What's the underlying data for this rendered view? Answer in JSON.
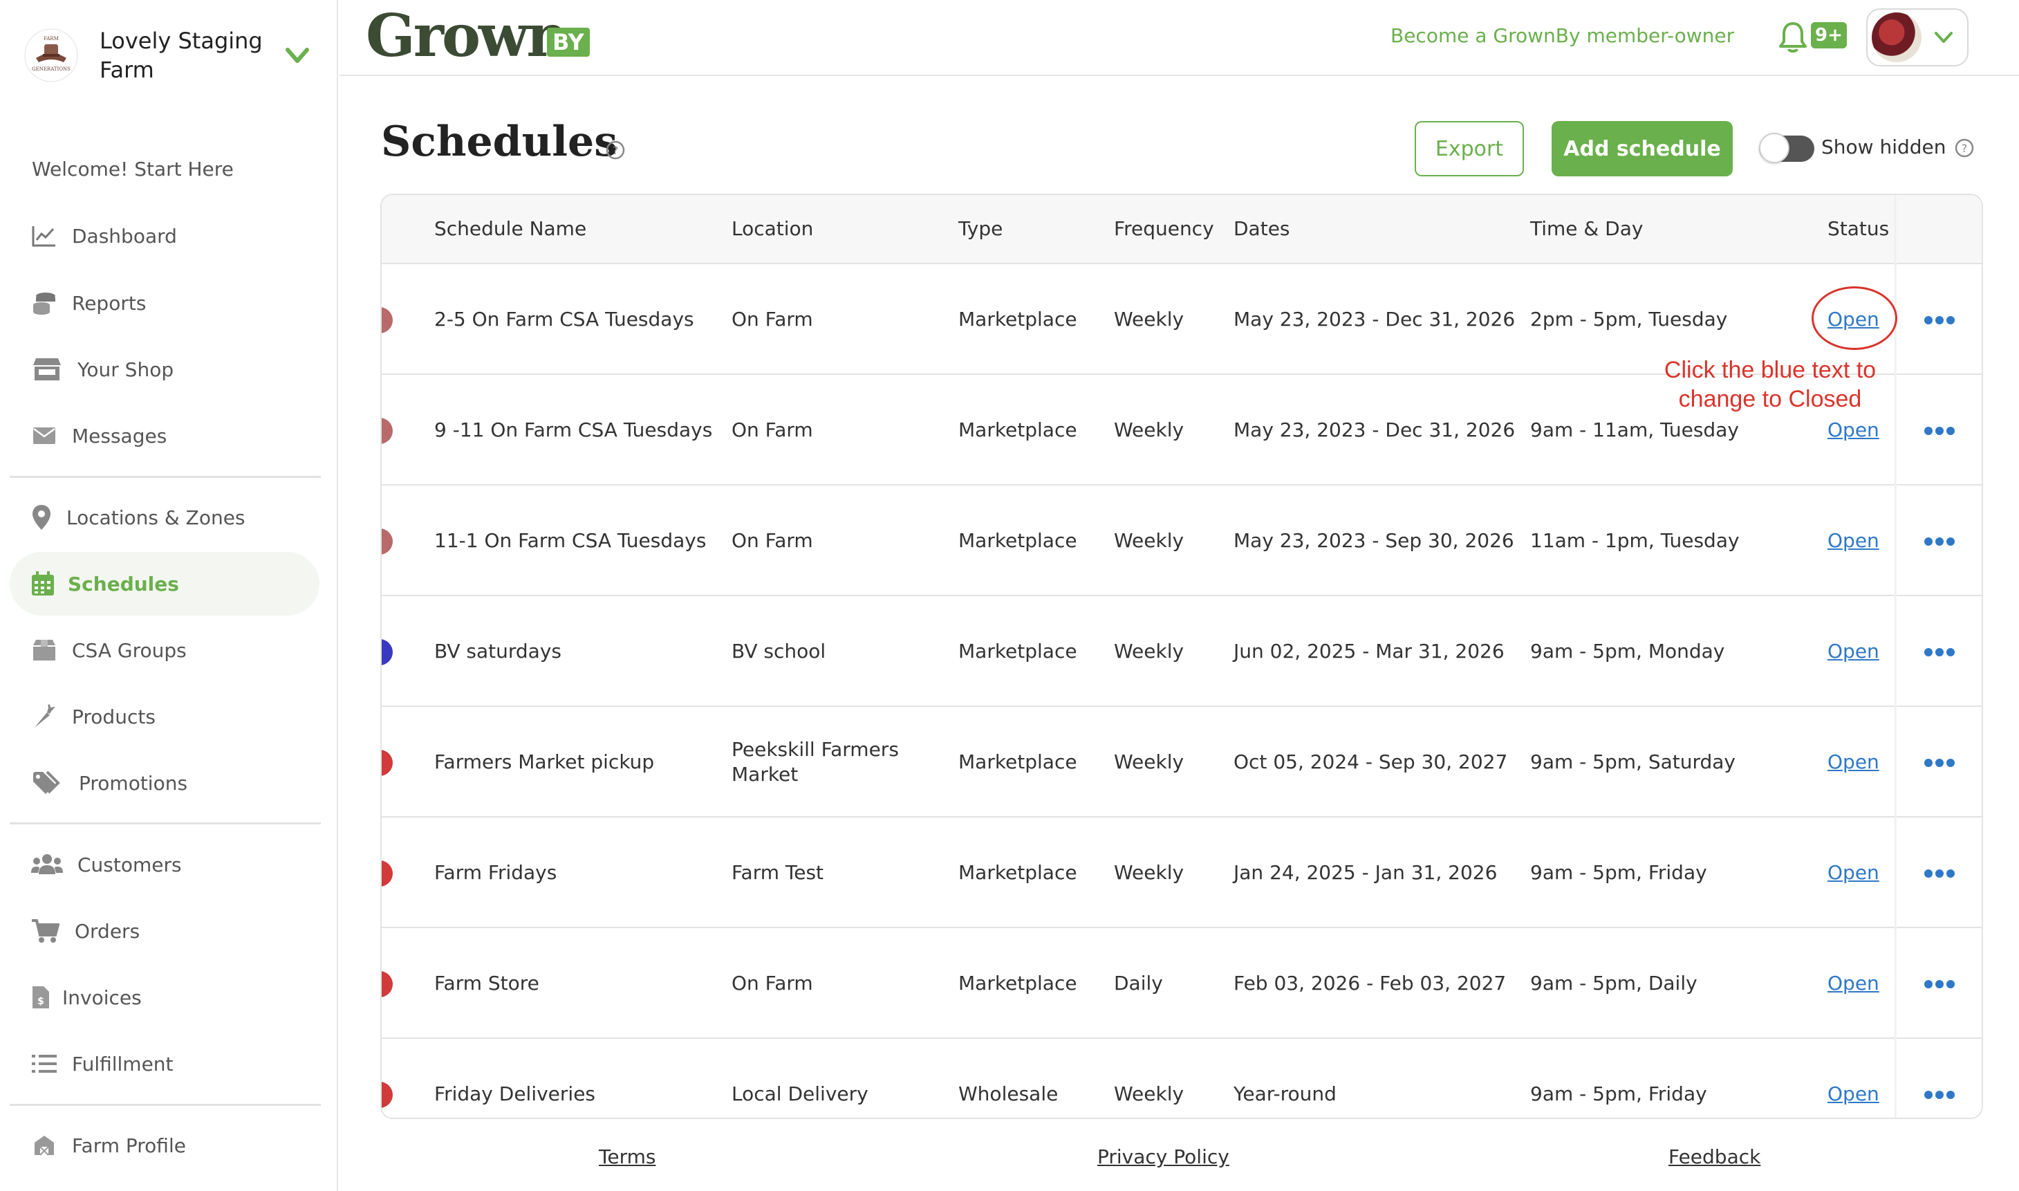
{
  "sidebar": {
    "farm_name": "Lovely Staging Farm",
    "welcome": "Welcome! Start Here",
    "items": [
      {
        "label": "Dashboard",
        "icon": "chart-line-icon"
      },
      {
        "label": "Reports",
        "icon": "coins-icon"
      },
      {
        "label": "Your Shop",
        "icon": "store-icon"
      },
      {
        "label": "Messages",
        "icon": "envelope-icon"
      },
      {
        "label": "Locations & Zones",
        "icon": "map-pin-icon"
      },
      {
        "label": "Schedules",
        "icon": "calendar-icon",
        "active": true
      },
      {
        "label": "CSA Groups",
        "icon": "box-icon"
      },
      {
        "label": "Products",
        "icon": "carrot-icon"
      },
      {
        "label": "Promotions",
        "icon": "tags-icon"
      },
      {
        "label": "Customers",
        "icon": "users-icon"
      },
      {
        "label": "Orders",
        "icon": "cart-icon"
      },
      {
        "label": "Invoices",
        "icon": "invoice-icon"
      },
      {
        "label": "Fulfillment",
        "icon": "list-icon"
      },
      {
        "label": "Farm Profile",
        "icon": "farm-icon"
      }
    ]
  },
  "header": {
    "brand": "Grown",
    "brand_suffix": "BY",
    "member_link": "Become a GrownBy member-owner",
    "notification_badge": "9+"
  },
  "page": {
    "title": "Schedules",
    "export_label": "Export",
    "add_label": "Add schedule",
    "show_hidden_label": "Show hidden",
    "show_hidden_on": false
  },
  "table": {
    "columns": [
      "Schedule Name",
      "Location",
      "Type",
      "Frequency",
      "Dates",
      "Time & Day",
      "Status"
    ],
    "rows": [
      {
        "color": "#b86a6a",
        "name": "2-5 On Farm CSA Tuesdays",
        "location": "On Farm",
        "type": "Marketplace",
        "frequency": "Weekly",
        "dates": "May 23, 2023 - Dec 31, 2026",
        "time": "2pm - 5pm, Tuesday",
        "status": "Open"
      },
      {
        "color": "#b86a6a",
        "name": "9 -11 On Farm CSA Tuesdays",
        "location": "On Farm",
        "type": "Marketplace",
        "frequency": "Weekly",
        "dates": "May 23, 2023 - Dec 31, 2026",
        "time": "9am - 11am, Tuesday",
        "status": "Open"
      },
      {
        "color": "#b86a6a",
        "name": "11-1 On Farm CSA Tuesdays",
        "location": "On Farm",
        "type": "Marketplace",
        "frequency": "Weekly",
        "dates": "May 23, 2023 - Sep 30, 2026",
        "time": "11am - 1pm, Tuesday",
        "status": "Open"
      },
      {
        "color": "#3a3ac0",
        "name": "BV saturdays",
        "location": "BV school",
        "type": "Marketplace",
        "frequency": "Weekly",
        "dates": "Jun 02, 2025 - Mar 31, 2026",
        "time": "9am - 5pm, Monday",
        "status": "Open"
      },
      {
        "color": "#d03a3a",
        "name": "Farmers Market pickup",
        "location": "Peekskill Farmers Market",
        "type": "Marketplace",
        "frequency": "Weekly",
        "dates": "Oct 05, 2024 - Sep 30, 2027",
        "time": "9am - 5pm, Saturday",
        "status": "Open"
      },
      {
        "color": "#d03a3a",
        "name": "Farm Fridays",
        "location": "Farm Test",
        "type": "Marketplace",
        "frequency": "Weekly",
        "dates": "Jan 24, 2025 - Jan 31, 2026",
        "time": "9am - 5pm, Friday",
        "status": "Open"
      },
      {
        "color": "#d03a3a",
        "name": "Farm Store",
        "location": "On Farm",
        "type": "Marketplace",
        "frequency": "Daily",
        "dates": "Feb 03, 2026 - Feb 03, 2027",
        "time": "9am - 5pm, Daily",
        "status": "Open"
      },
      {
        "color": "#d03a3a",
        "name": "Friday Deliveries",
        "location": "Local Delivery",
        "type": "Wholesale",
        "frequency": "Weekly",
        "dates": "Year-round",
        "time": "9am - 5pm, Friday",
        "status": "Open"
      }
    ]
  },
  "annotation": {
    "text": "Click the blue text to change to Closed",
    "color": "#d9342b"
  },
  "footer": {
    "terms": "Terms",
    "privacy": "Privacy Policy",
    "feedback": "Feedback"
  },
  "colors": {
    "accent": "#6ab04c",
    "link": "#2e78c7",
    "brand_dark": "#3c4b34"
  }
}
